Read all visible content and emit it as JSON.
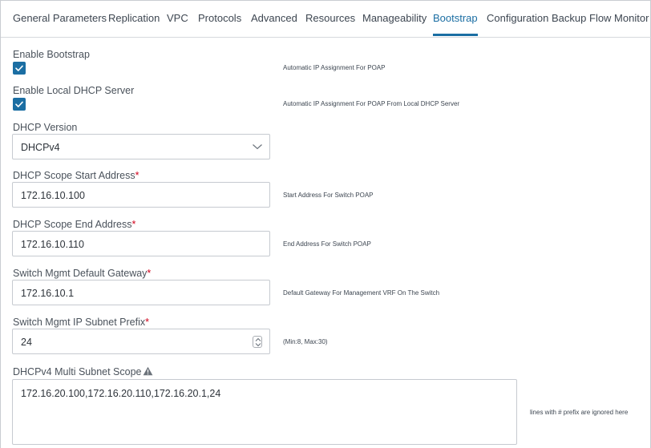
{
  "tabs": [
    {
      "label": "General Parameters",
      "active": false
    },
    {
      "label": "Replication",
      "active": false
    },
    {
      "label": "VPC",
      "active": false
    },
    {
      "label": "Protocols",
      "active": false
    },
    {
      "label": "Advanced",
      "active": false
    },
    {
      "label": "Resources",
      "active": false
    },
    {
      "label": "Manageability",
      "active": false
    },
    {
      "label": "Bootstrap",
      "active": true
    },
    {
      "label": "Configuration Backup",
      "active": false
    },
    {
      "label": "Flow Monitor",
      "active": false
    }
  ],
  "enable_bootstrap": {
    "label": "Enable Bootstrap",
    "checked": true,
    "hint": "Automatic IP Assignment For POAP"
  },
  "enable_local_dhcp": {
    "label": "Enable Local DHCP Server",
    "checked": true,
    "hint": "Automatic IP Assignment For POAP From Local DHCP Server"
  },
  "dhcp_version": {
    "label": "DHCP Version",
    "value": "DHCPv4"
  },
  "scope_start": {
    "label": "DHCP Scope Start Address",
    "required_mark": "*",
    "value": "172.16.10.100",
    "hint": "Start Address For Switch POAP"
  },
  "scope_end": {
    "label": "DHCP Scope End Address",
    "required_mark": "*",
    "value": "172.16.10.110",
    "hint": "End Address For Switch POAP"
  },
  "mgmt_gateway": {
    "label": "Switch Mgmt Default Gateway",
    "required_mark": "*",
    "value": "172.16.10.1",
    "hint": "Default Gateway For Management VRF On The Switch"
  },
  "mgmt_prefix": {
    "label": "Switch Mgmt IP Subnet Prefix",
    "required_mark": "*",
    "value": "24",
    "hint": "(Min:8, Max:30)"
  },
  "multi_subnet_scope": {
    "label": "DHCPv4 Multi Subnet Scope",
    "icon": "warning-icon",
    "value": "172.16.20.100,172.16.20.110,172.16.20.1,24",
    "hint": "lines with # prefix are ignored here"
  },
  "colors": {
    "accent": "#1b6ea3",
    "required": "#d0021b"
  }
}
